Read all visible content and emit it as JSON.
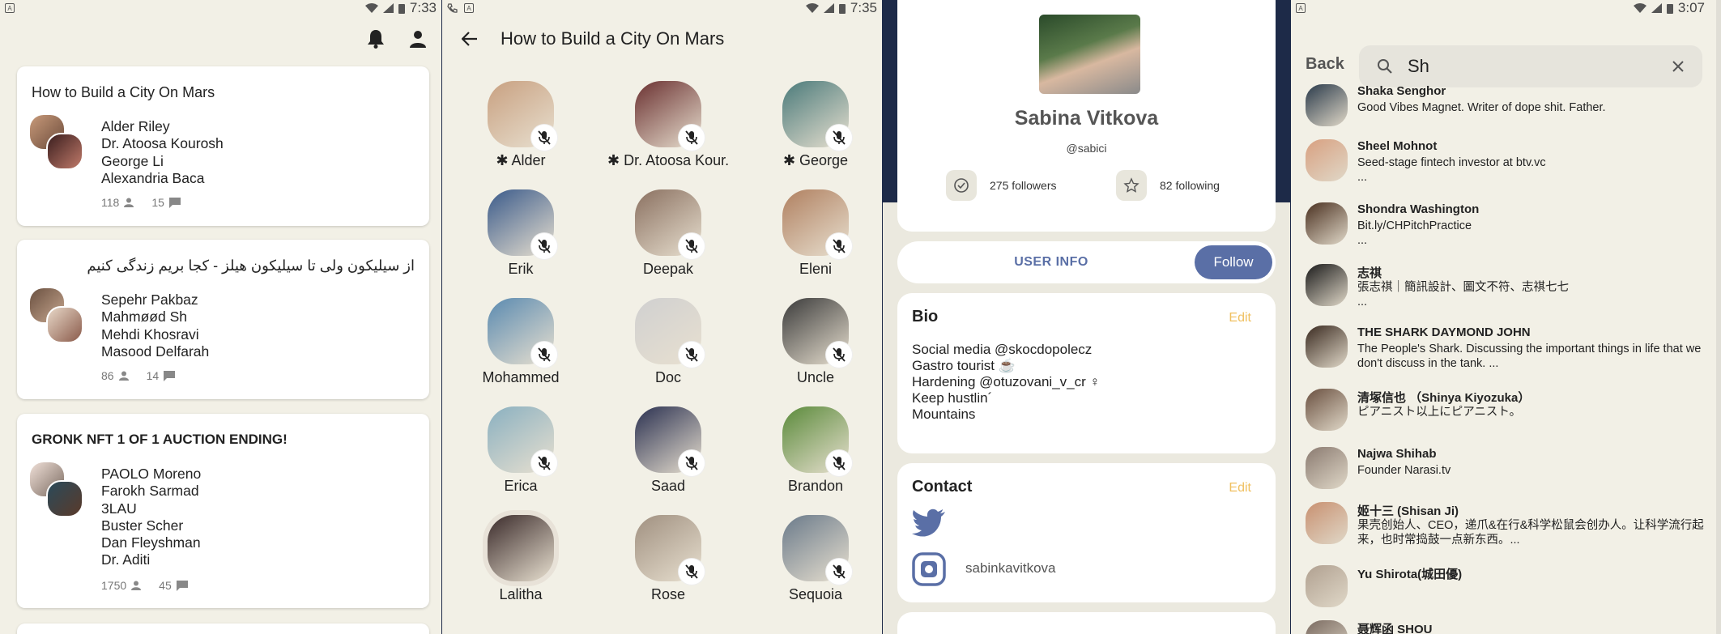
{
  "colors": {
    "bg": "#f2f0e6",
    "navy": "#1d2a48",
    "accent": "#5a6fa6",
    "edit": "#f0c060"
  },
  "screen1": {
    "status_time": "7:33",
    "rooms": [
      {
        "title": "How to Build a City On Mars",
        "names": [
          "Alder Riley ",
          "Dr. Atoosa Kourosh ",
          "George Li ",
          "Alexandria Baca"
        ],
        "listeners": "118",
        "speakers": "15"
      },
      {
        "title": "از سیلیکون ولی تا سیلیکون هیلز - کجا بریم زندگی کنیم",
        "names": [
          "Sepehr Pakbaz ",
          "Mahmøød Sh ",
          "Mehdi Khosravi ",
          "Masood Delfarah"
        ],
        "listeners": "86",
        "speakers": "14"
      },
      {
        "title": "GRONK NFT 1 OF 1 AUCTION ENDING! ",
        "names": [
          "PAOLO Moreno ",
          "Farokh Sarmad ",
          "3LAU ",
          "Buster Scher ",
          "Dan Fleyshman ",
          "Dr. Aditi "
        ],
        "listeners": "1750",
        "speakers": "45"
      }
    ]
  },
  "screen2": {
    "status_time": "7:35",
    "title": "How to Build a City On Mars",
    "speakers": [
      {
        "name": "✱ Alder",
        "muted": true
      },
      {
        "name": "✱ Dr. Atoosa Kour...",
        "muted": true
      },
      {
        "name": "✱ George",
        "muted": true
      },
      {
        "name": "Erik",
        "muted": true
      },
      {
        "name": "Deepak",
        "muted": true
      },
      {
        "name": "Eleni",
        "muted": true
      },
      {
        "name": "Mohammed",
        "muted": true
      },
      {
        "name": "Doc",
        "muted": true
      },
      {
        "name": "Uncle",
        "muted": true
      },
      {
        "name": "Erica",
        "muted": true
      },
      {
        "name": "Saad",
        "muted": true
      },
      {
        "name": "Brandon",
        "muted": true
      },
      {
        "name": "Lalitha",
        "muted": false
      },
      {
        "name": "Rose",
        "muted": true
      },
      {
        "name": "Sequoia",
        "muted": true
      }
    ]
  },
  "screen3": {
    "name": "Sabina Vitkova",
    "handle": "@sabici",
    "followers": "275 followers",
    "following": "82 following",
    "tab_label": "USER INFO",
    "follow_label": "Follow",
    "bio_title": "Bio",
    "edit_label": "Edit",
    "bio": "Social media @skocdopolecz \nGastro tourist ☕\nHardening @otuzovani_v_cr ♀\nKeep hustlin´ \nMountains \n",
    "contact_title": "Contact",
    "instagram": "sabinkavitkova"
  },
  "screen4": {
    "status_time": "3:07",
    "back_label": "Back",
    "search_value": "Sh",
    "results": [
      {
        "name": "Shaka Senghor",
        "bio": "Good Vibes Magnet. Writer of dope shit. Father."
      },
      {
        "name": "Sheel Mohnot",
        "bio": "Seed-stage fintech investor at btv.vc\n..."
      },
      {
        "name": "Shondra Washington",
        "bio": "Bit.ly/CHPitchPractice\n ..."
      },
      {
        "name": "志祺",
        "bio": "張志祺｜簡訊設計、圖文不符、志祺七七\n..."
      },
      {
        "name": "THE SHARK DAYMOND JOHN",
        "bio": "The People's Shark. Discussing the important things in life that we don't discuss in the tank. ..."
      },
      {
        "name": "清塚信也 （Shinya Kiyozuka）",
        "bio": "ピアニスト以上にピアニスト。"
      },
      {
        "name": "Najwa Shihab",
        "bio": "Founder Narasi.tv"
      },
      {
        "name": "姬十三 (Shisan Ji)",
        "bio": "果壳创始人、CEO，递爪&在行&科学松鼠会创办人。让科学流行起来，也时常捣鼓一点新东西。..."
      },
      {
        "name": "Yu Shirota(城田優)",
        "bio": ""
      },
      {
        "name": "聂辉函 SHOU",
        "bio": ""
      }
    ]
  }
}
